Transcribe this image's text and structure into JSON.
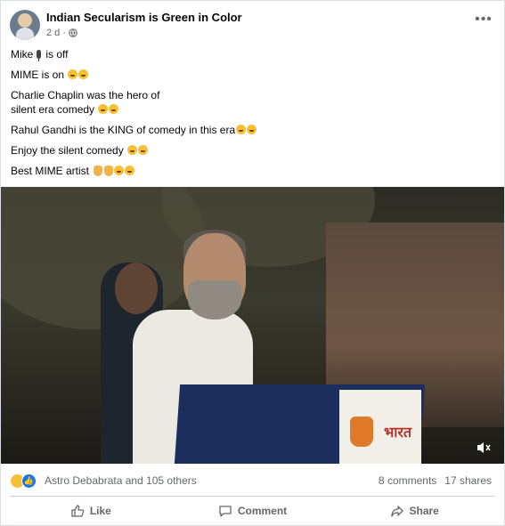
{
  "post": {
    "page_name": "Indian Secularism is Green in Color",
    "time": "2 d ·",
    "lines": {
      "line1_a": "Mike",
      "line1_b": "is off",
      "line2": "MIME is on",
      "line3_a": "Charlie Chaplin was the hero of",
      "line3_b": "silent era comedy",
      "line4": "Rahul Gandhi is the KING of comedy in this era",
      "line5": "Enjoy the silent comedy",
      "line6": "Best MIME artist"
    },
    "video_sign_text": "भारत"
  },
  "reactions": {
    "names": "Astro Debabrata and 105 others",
    "comments": "8 comments",
    "shares": "17 shares"
  },
  "actions": {
    "like": "Like",
    "comment": "Comment",
    "share": "Share"
  },
  "icons": [
    "globe-icon",
    "more-icon",
    "mute-icon",
    "like-icon",
    "comment-icon",
    "share-icon"
  ],
  "colors": {
    "like_blue": "#1877f2",
    "secondary_text": "#65676b"
  }
}
